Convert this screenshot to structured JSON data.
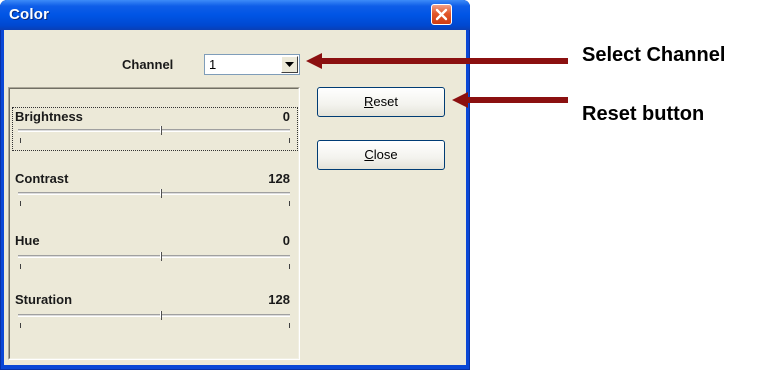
{
  "window": {
    "title": "Color"
  },
  "channel": {
    "label": "Channel",
    "value": "1"
  },
  "sliders": [
    {
      "label": "Brightness",
      "value": "0"
    },
    {
      "label": "Contrast",
      "value": "128"
    },
    {
      "label": "Hue",
      "value": "0"
    },
    {
      "label": "Sturation",
      "value": "128"
    }
  ],
  "buttons": {
    "reset": {
      "mnemonic": "R",
      "rest": "eset"
    },
    "close": {
      "mnemonic": "C",
      "rest": "lose"
    }
  },
  "annotations": {
    "select_channel": "Select Channel",
    "reset_button": "Reset button",
    "arrow_color": "#8b1010"
  },
  "icons": [
    "close-icon",
    "dropdown-arrow-icon",
    "arrow-left-icon"
  ]
}
